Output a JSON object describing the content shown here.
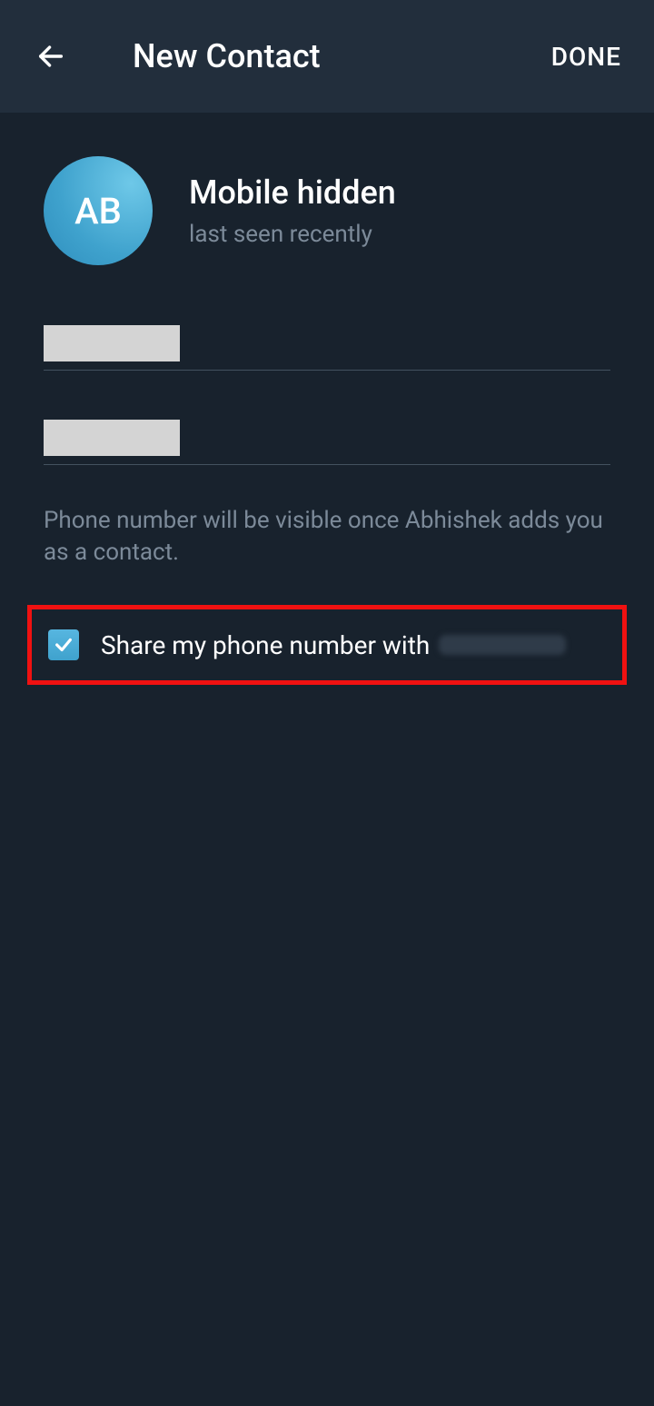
{
  "header": {
    "title": "New Contact",
    "done_label": "DONE"
  },
  "profile": {
    "avatar_initials": "AB",
    "name": "Mobile hidden",
    "status": "last seen recently"
  },
  "fields": {
    "first_name_value": "",
    "last_name_value": ""
  },
  "hint": "Phone number will be visible once Abhishek adds you as a contact.",
  "share": {
    "checked": true,
    "label_prefix": "Share my phone number with"
  },
  "colors": {
    "accent": "#3fa2cd",
    "highlight_border": "#f01111"
  }
}
